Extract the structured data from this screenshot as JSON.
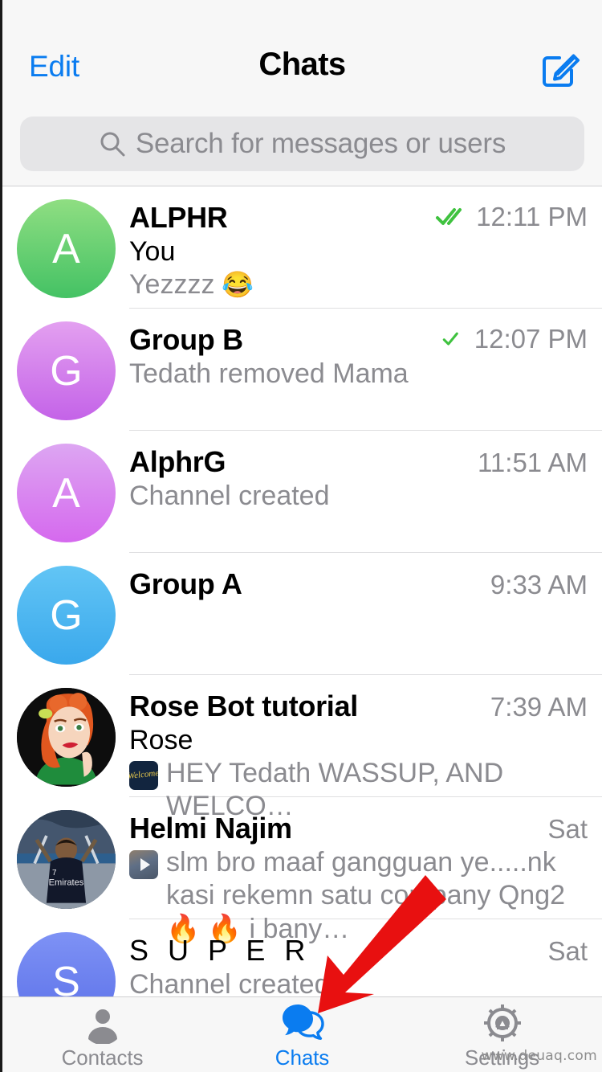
{
  "app": {
    "accent_color": "#0a7cf0",
    "check_color": "#3fc23f",
    "annotation_color": "#e81010",
    "watermark": "www.deuaq.com"
  },
  "header": {
    "edit_label": "Edit",
    "title": "Chats",
    "compose_icon": "compose-icon"
  },
  "search": {
    "icon": "search-icon",
    "placeholder": "Search for messages or users",
    "value": ""
  },
  "chats": [
    {
      "title": "ALPHR",
      "avatar_letter": "A",
      "avatar_type": "letter",
      "avatar_color_start": "#8fde82",
      "avatar_color_end": "#44c264",
      "sender": "You",
      "preview": "Yezzzz",
      "preview_emoji": "😂",
      "thumb": "",
      "time": "12:11 PM",
      "status": "read"
    },
    {
      "title": "Group B",
      "avatar_letter": "G",
      "avatar_type": "letter",
      "avatar_color_start": "#e3a0f0",
      "avatar_color_end": "#c463e8",
      "sender": "",
      "preview": "Tedath removed Mama",
      "preview_emoji": "",
      "thumb": "",
      "time": "12:07 PM",
      "status": "sent"
    },
    {
      "title": "AlphrG",
      "avatar_letter": "A",
      "avatar_type": "letter",
      "avatar_color_start": "#dda6f2",
      "avatar_color_end": "#d569ee",
      "sender": "",
      "preview": "Channel created",
      "preview_emoji": "",
      "thumb": "",
      "time": "11:51 AM",
      "status": "none"
    },
    {
      "title": "Group A",
      "avatar_letter": "G",
      "avatar_type": "letter",
      "avatar_color_start": "#62c5f5",
      "avatar_color_end": "#3aa8ec",
      "sender": "",
      "preview": "",
      "preview_emoji": "",
      "thumb": "",
      "time": "9:33 AM",
      "status": "none"
    },
    {
      "title": "Rose Bot tutorial",
      "avatar_letter": "",
      "avatar_type": "rose-bot-photo",
      "avatar_color_start": "#101010",
      "avatar_color_end": "#101010",
      "sender": "Rose",
      "preview": "HEY Tedath WASSUP, AND WELCO…",
      "preview_emoji": "",
      "thumb": "welcome-sticker-thumbnail",
      "time": "7:39 AM",
      "status": "none"
    },
    {
      "title": "Helmi Najim",
      "avatar_letter": "",
      "avatar_type": "child-photo",
      "avatar_color_start": "#2b3b52",
      "avatar_color_end": "#1a2533",
      "sender": "",
      "preview": "slm bro maaf gangguan ye.....nk kasi rekemn satu company Qng2 🔥 🔥 i bany…",
      "preview_emoji": "",
      "thumb": "video-thumbnail",
      "time": "Sat",
      "status": "none"
    },
    {
      "title": "S U P E R",
      "avatar_letter": "S",
      "avatar_type": "letter",
      "avatar_color_start": "#7e92f5",
      "avatar_color_end": "#5a6fe8",
      "sender": "",
      "preview": "Channel created",
      "preview_emoji": "",
      "thumb": "",
      "time": "Sat",
      "status": "none"
    }
  ],
  "tabs": [
    {
      "label": "Contacts",
      "icon": "contacts-icon",
      "active": false
    },
    {
      "label": "Chats",
      "icon": "chats-icon",
      "active": true
    },
    {
      "label": "Settings",
      "icon": "settings-icon",
      "active": false
    }
  ]
}
